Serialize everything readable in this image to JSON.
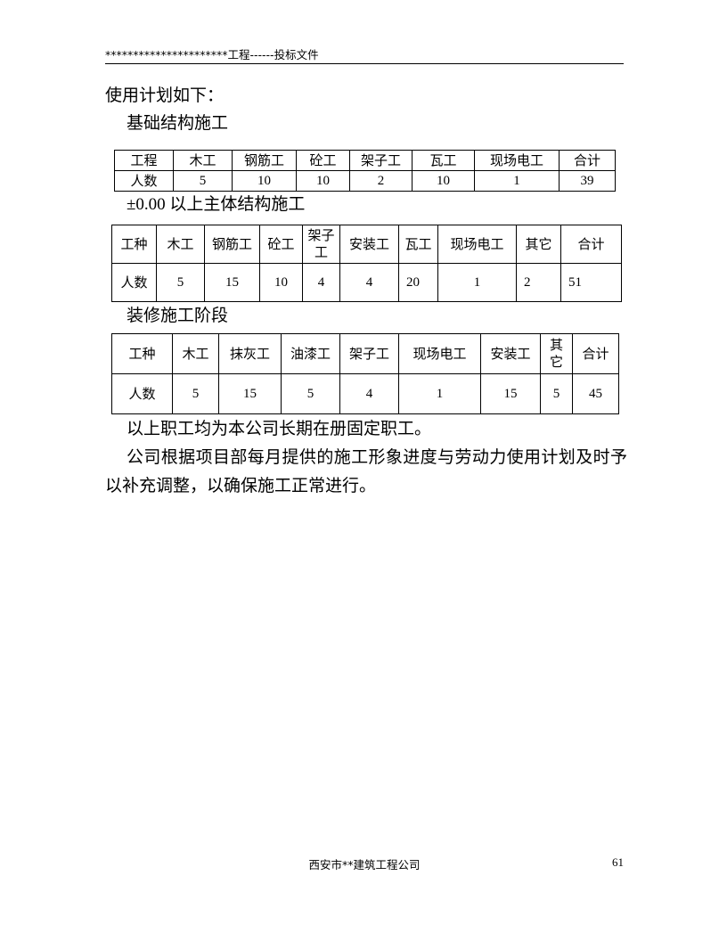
{
  "header": {
    "text": "**********************工程------投标文件"
  },
  "body": {
    "intro": "使用计划如下：",
    "section1_heading": "基础结构施工",
    "section2_heading": "±0.00 以上主体结构施工",
    "section3_heading": "装修施工阶段",
    "note1": "以上职工均为本公司长期在册固定职工。",
    "note2": "公司根据项目部每月提供的施工形象进度与劳动力使用计划及时予以补充调整，以确保施工正常进行。"
  },
  "table1": {
    "headers": [
      "工程",
      "木工",
      "钢筋工",
      "砼工",
      "架子工",
      "瓦工",
      "现场电工",
      "合计"
    ],
    "row_label": "人数",
    "values": [
      "5",
      "10",
      "10",
      "2",
      "10",
      "1",
      "39"
    ]
  },
  "table2": {
    "headers": [
      "工种",
      "木工",
      "钢筋工",
      "砼工",
      "架子工",
      "安装工",
      "瓦工",
      "现场电工",
      "其它",
      "合计"
    ],
    "row_label": "人数",
    "values": [
      "5",
      "15",
      "10",
      "4",
      "4",
      "20",
      "1",
      "2",
      "51"
    ]
  },
  "table3": {
    "headers": [
      "工种",
      "木工",
      "抹灰工",
      "油漆工",
      "架子工",
      "现场电工",
      "安装工",
      "其它",
      "合计"
    ],
    "row_label": "人数",
    "values": [
      "5",
      "15",
      "5",
      "4",
      "1",
      "15",
      "5",
      "45"
    ]
  },
  "footer": {
    "company": "西安市**建筑工程公司",
    "page_number": "61"
  }
}
